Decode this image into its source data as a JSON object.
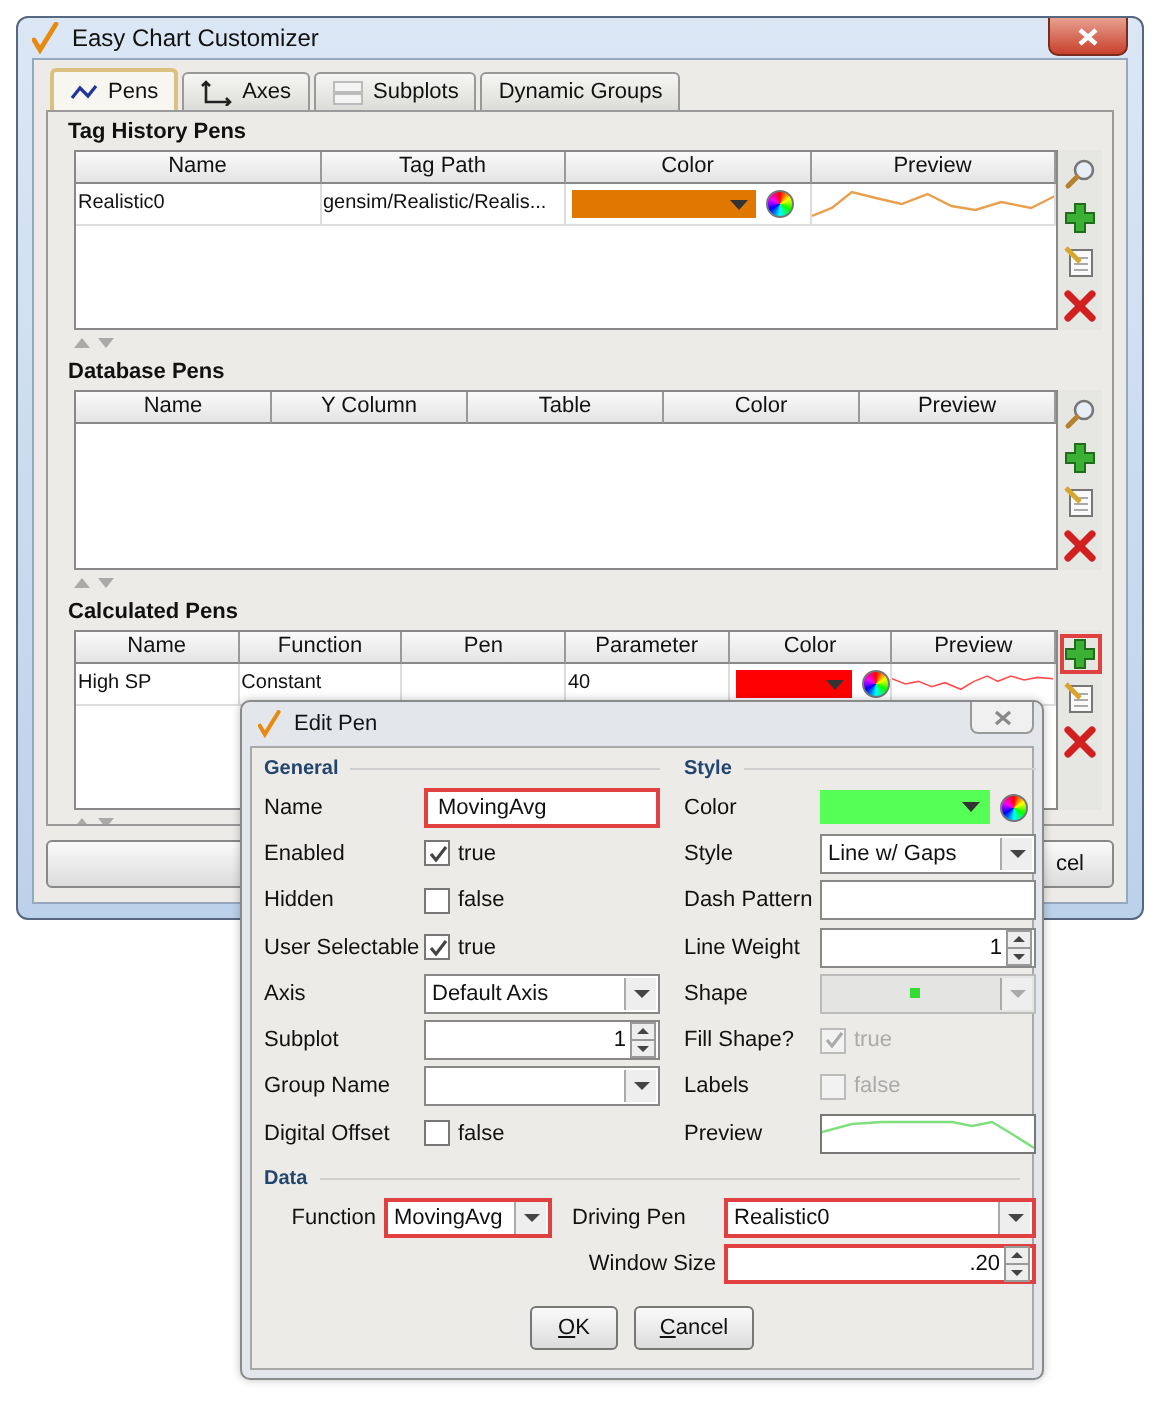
{
  "window": {
    "title": "Easy Chart Customizer"
  },
  "tabs": [
    {
      "label": "Pens",
      "selected": true
    },
    {
      "label": "Axes",
      "selected": false
    },
    {
      "label": "Subplots",
      "selected": false
    },
    {
      "label": "Dynamic Groups",
      "selected": false
    }
  ],
  "sections": [
    {
      "title": "Tag History Pens",
      "columns": [
        "Name",
        "Tag Path",
        "Color",
        "Preview"
      ],
      "rows": [
        {
          "cells": [
            "Realistic0",
            "gensim/Realistic/Realis..."
          ],
          "color": "#e07800"
        }
      ],
      "tools": [
        {
          "kind": "search",
          "highlighted": false
        },
        {
          "kind": "add",
          "highlighted": false
        },
        {
          "kind": "edit",
          "highlighted": false
        },
        {
          "kind": "delete",
          "highlighted": false
        }
      ]
    },
    {
      "title": "Database Pens",
      "columns": [
        "Name",
        "Y Column",
        "Table",
        "Color",
        "Preview"
      ],
      "tools": [
        {
          "kind": "search",
          "highlighted": false
        },
        {
          "kind": "add",
          "highlighted": false
        },
        {
          "kind": "edit",
          "highlighted": false
        },
        {
          "kind": "delete",
          "highlighted": false
        }
      ]
    },
    {
      "title": "Calculated Pens",
      "columns": [
        "Name",
        "Function",
        "Pen",
        "Parameter",
        "Color",
        "Preview"
      ],
      "rows": [
        {
          "cells": [
            "High SP",
            "Constant",
            null,
            "40"
          ],
          "color": "#ff0000"
        }
      ],
      "tools": [
        {
          "kind": "add",
          "highlighted": true
        },
        {
          "kind": "edit",
          "highlighted": false
        },
        {
          "kind": "delete",
          "highlighted": false
        }
      ]
    }
  ],
  "footer_buttons": [
    {
      "label": "cel"
    }
  ],
  "dialog": {
    "title": "Edit Pen",
    "columns": [
      {
        "heading": "General",
        "fields": [
          {
            "label": "Name",
            "kind": "text",
            "value": "MovingAvg",
            "highlighted": true,
            "disabled": false
          },
          {
            "label": "Enabled",
            "kind": "checkbox",
            "checked": true,
            "value": "true",
            "highlighted": false,
            "disabled": false
          },
          {
            "label": "Hidden",
            "kind": "checkbox",
            "checked": false,
            "value": "false",
            "highlighted": false,
            "disabled": false
          },
          {
            "label": "User Selectable",
            "kind": "checkbox",
            "checked": true,
            "value": "true",
            "highlighted": false,
            "disabled": false
          },
          {
            "label": "Axis",
            "kind": "dropdown",
            "value": "Default Axis",
            "highlighted": false,
            "disabled": false
          },
          {
            "label": "Subplot",
            "kind": "spinner",
            "value": "1",
            "highlighted": false,
            "disabled": false
          },
          {
            "label": "Group Name",
            "kind": "dropdown",
            "highlighted": false,
            "disabled": false
          },
          {
            "label": "Digital Offset",
            "kind": "checkbox",
            "checked": false,
            "value": "false",
            "highlighted": false,
            "disabled": false
          }
        ]
      },
      {
        "heading": "Style",
        "fields": [
          {
            "label": "Color",
            "kind": "color",
            "color": "#55ff55",
            "highlighted": false,
            "disabled": false
          },
          {
            "label": "Style",
            "kind": "dropdown",
            "value": "Line w/ Gaps",
            "highlighted": false,
            "disabled": false
          },
          {
            "label": "Dash Pattern",
            "kind": "text",
            "highlighted": false,
            "disabled": false
          },
          {
            "label": "Line Weight",
            "kind": "spinner",
            "value": "1",
            "highlighted": false,
            "disabled": false
          },
          {
            "label": "Shape",
            "kind": "shape",
            "highlighted": false,
            "disabled": true
          },
          {
            "label": "Fill Shape?",
            "kind": "checkbox",
            "checked": true,
            "value": "true",
            "highlighted": false,
            "disabled": true
          },
          {
            "label": "Labels",
            "kind": "checkbox",
            "checked": false,
            "value": "false",
            "highlighted": false,
            "disabled": true
          },
          {
            "label": "Preview",
            "kind": "preview",
            "highlighted": false,
            "disabled": false
          }
        ]
      }
    ],
    "data": {
      "heading": "Data",
      "fields": [
        {
          "label": "Function",
          "kind": "dropdown",
          "value": "MovingAvg",
          "highlighted": true
        },
        {
          "label": "Driving Pen",
          "kind": "dropdown",
          "value": "Realistic0",
          "highlighted": true
        },
        {
          "label": "Window Size",
          "kind": "spinner",
          "value": ".20",
          "highlighted": true
        }
      ]
    },
    "buttons": [
      {
        "mnemonic": "O",
        "rest": "K"
      },
      {
        "mnemonic": "C",
        "rest": "ancel"
      }
    ]
  }
}
